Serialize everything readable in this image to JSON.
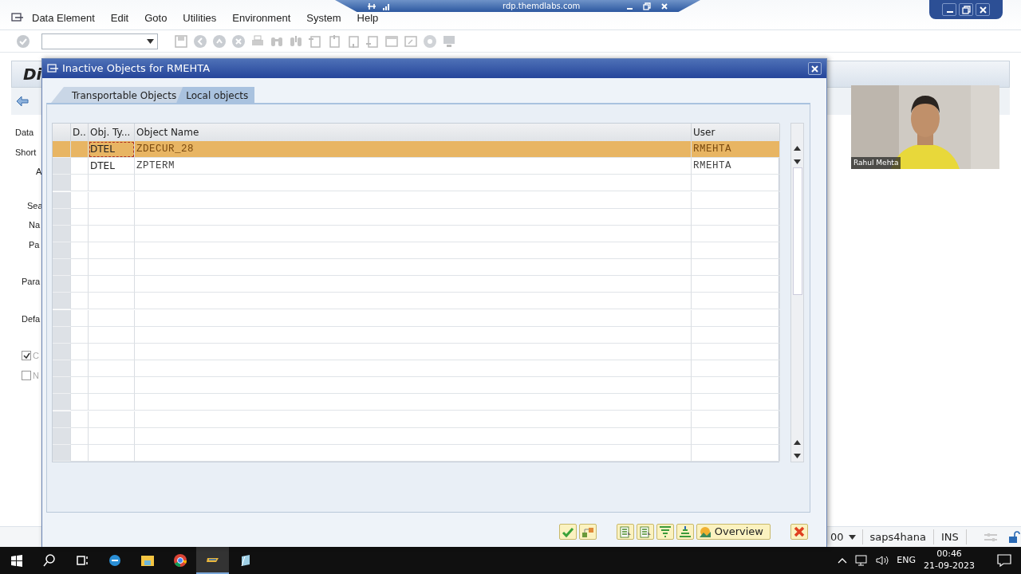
{
  "menu": [
    "Data Element",
    "Edit",
    "Goto",
    "Utilities",
    "Environment",
    "System",
    "Help"
  ],
  "rdp_bar": {
    "title": "rdp.themdlabs.com"
  },
  "background": {
    "title": "Di",
    "labels": [
      "Data",
      "Short",
      "A",
      "Sea",
      "Na",
      "Pa",
      "Para",
      "Defa"
    ],
    "checkboxes": [
      {
        "label": "C",
        "checked": true
      },
      {
        "label": "N",
        "checked": false
      }
    ]
  },
  "dialog": {
    "title": "Inactive Objects for RMEHTA",
    "tabs": [
      {
        "label": "Transportable Objects",
        "selected": false
      },
      {
        "label": "Local objects",
        "selected": true
      }
    ],
    "table": {
      "columns": [
        "D..",
        "Obj. Ty...",
        "Object Name",
        "User"
      ],
      "rows": [
        {
          "obj_type": "DTEL",
          "object_name": "ZDECUR_28",
          "user": "RMEHTA",
          "selected": true
        },
        {
          "obj_type": "DTEL",
          "object_name": "ZPTERM",
          "user": "RMEHTA",
          "selected": false
        }
      ]
    },
    "buttons": [
      {
        "kind": "confirm"
      },
      {
        "kind": "transport"
      },
      {
        "kind": "list"
      },
      {
        "kind": "list"
      },
      {
        "kind": "filter"
      },
      {
        "kind": "sort"
      },
      {
        "kind": "overview",
        "label": "Overview"
      },
      {
        "kind": "cancel"
      }
    ]
  },
  "status_bar": {
    "client": "00",
    "system": "saps4hana",
    "mode": "INS"
  },
  "webcam": {
    "name": "Rahul Mehta"
  },
  "taskbar": {
    "language": "ENG",
    "time": "00:46",
    "date": "21-09-2023"
  }
}
